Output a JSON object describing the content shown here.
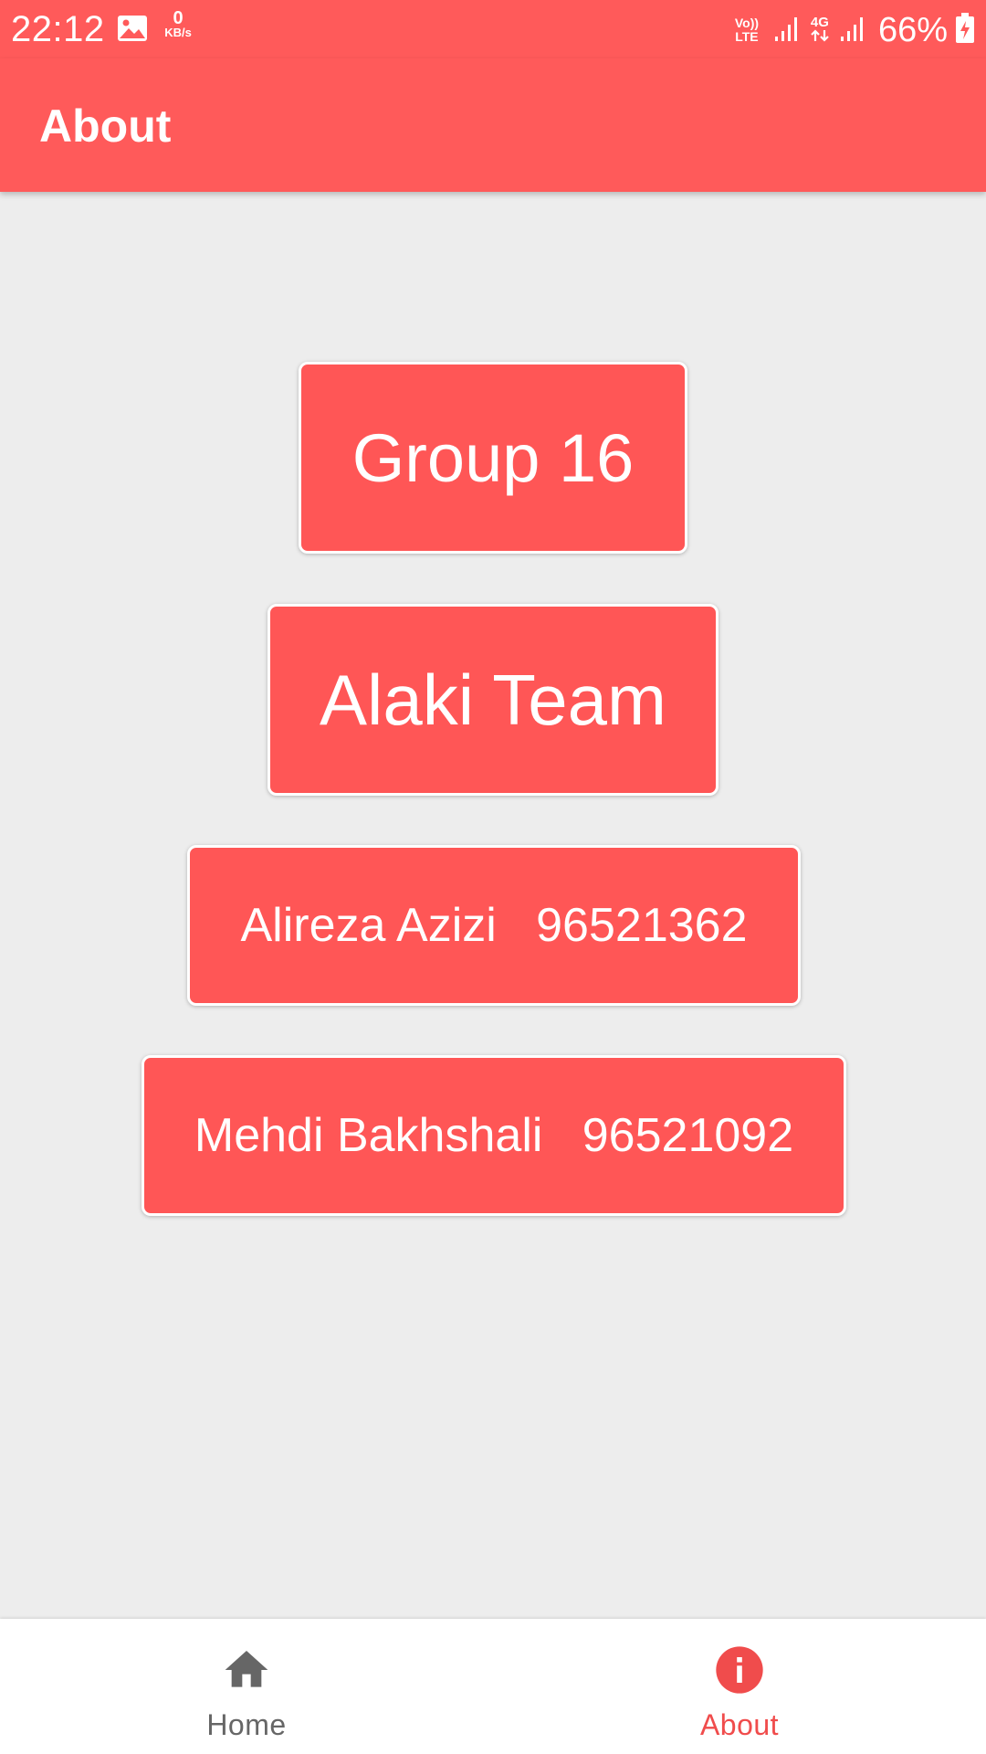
{
  "status_bar": {
    "time": "22:12",
    "speed_value": "0",
    "speed_unit": "KB/s",
    "volte_top": "Vo))",
    "volte_bottom": "LTE",
    "network": "4G",
    "battery": "66%"
  },
  "app_bar": {
    "title": "About"
  },
  "cards": {
    "group": "Group 16",
    "team": "Alaki Team",
    "member_1": "Alireza Azizi   96521362",
    "member_2": "Mehdi Bakhshali   96521092"
  },
  "bottom_nav": {
    "items": [
      {
        "label": "Home",
        "icon": "home-icon",
        "active": false
      },
      {
        "label": "About",
        "icon": "info-icon",
        "active": true
      }
    ]
  },
  "colors": {
    "primary": "#ff5a5a",
    "background": "#ededed",
    "nav_active": "#f04c4c",
    "nav_inactive": "#666666"
  }
}
